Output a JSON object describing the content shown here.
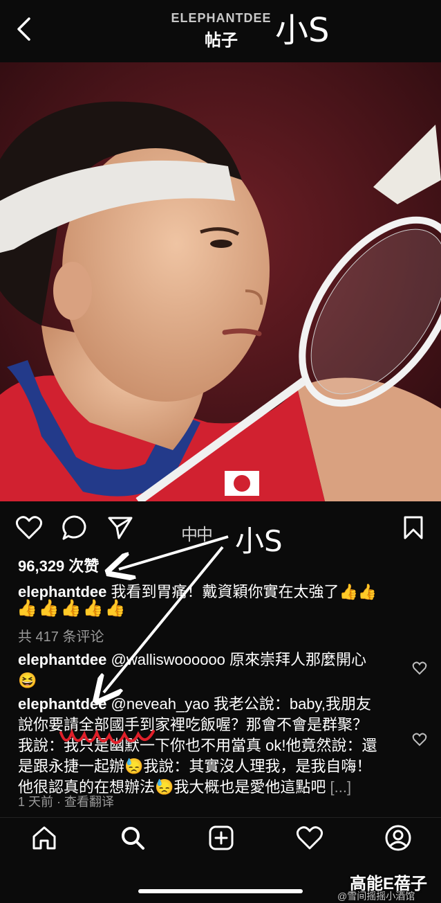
{
  "header": {
    "username": "ELEPHANTDEE",
    "title": "帖子",
    "overlay_mark": "小S"
  },
  "post": {
    "likes": "96,329 次赞",
    "caption_username": "elephantdee",
    "caption_text": "我看到胃痛！戴資穎你實在太強了👍👍",
    "caption_emojis": "👍👍👍👍👍",
    "view_comments": "共 417 条评论",
    "comments": [
      {
        "username": "elephantdee",
        "text": "@walliswoooooo 原來崇拜人那麼開心",
        "line2": "😆"
      },
      {
        "username": "elephantdee",
        "text": "@neveah_yao 我老公說：baby,我朋友",
        "line2": "說你要請全部國手到家裡吃飯喔？那會不會是群聚？",
        "line3": "我說：我只是幽默一下你也不用當真 ok!他竟然說：還",
        "line4": "是跟永捷一起辦😓我說：其實沒人理我，是我自嗨！",
        "line5": "他很認真的在想辦法😓我大概也是愛他這點吧",
        "more": "[...]"
      }
    ],
    "time": "1 天前",
    "separator": " · ",
    "translate": "查看翻译"
  },
  "annotation": {
    "mark": "小S",
    "ghost_text": "中中"
  },
  "icons": {
    "back": "chevron-left-icon",
    "like": "heart-icon",
    "comment": "speech-bubble-icon",
    "share": "send-icon",
    "save": "bookmark-icon",
    "nav": [
      "home-icon",
      "search-icon",
      "add-post-icon",
      "activity-heart-icon",
      "profile-icon"
    ]
  },
  "watermark": {
    "line1": "高能E蓓子",
    "line2": "@雪间摇摇小酒馆"
  },
  "colors": {
    "background": "#0b0b0b",
    "text": "#ffffff",
    "muted": "#9a9a9a",
    "annotation_red": "#e0202a"
  }
}
